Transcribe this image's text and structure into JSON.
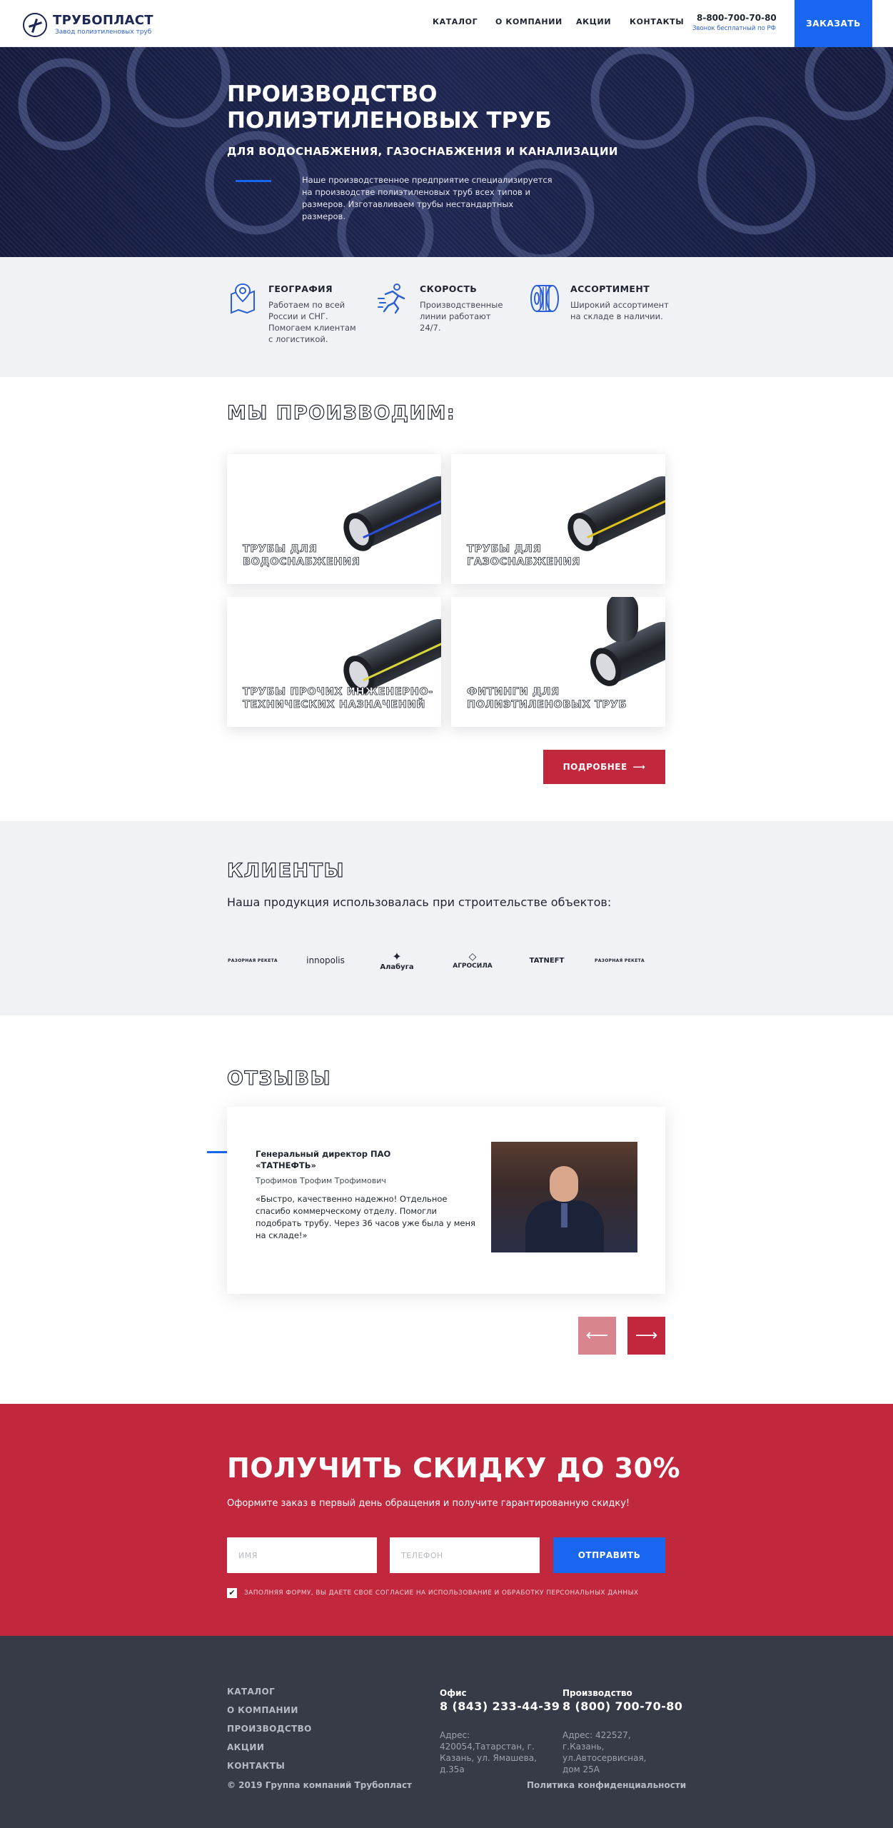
{
  "header": {
    "logo_title": "ТРУБОПЛАСТ",
    "logo_subtitle": "Завод полиэтиленовых труб",
    "nav": [
      "КАТАЛОГ",
      "О КОМПАНИИ",
      "АКЦИИ",
      "КОНТАКТЫ"
    ],
    "phone": "8-800-700-70-80",
    "phone_note": "Звонок бесплатный по РФ",
    "order_button": "ЗАКАЗАТЬ"
  },
  "hero": {
    "title": "ПРОИЗВОДСТВО ПОЛИЭТИЛЕНОВЫХ ТРУБ",
    "subtitle": "ДЛЯ ВОДОСНАБЖЕНИЯ, ГАЗОСНАБЖЕНИЯ И КАНАЛИЗАЦИИ",
    "text": "Наше производственное предприятие специализируется на производстве полиэтиленовых труб всех типов и размеров. Изготавливаем трубы нестандартных размеров."
  },
  "features": [
    {
      "icon": "map-pin-icon",
      "title": "ГЕОГРАФИЯ",
      "text": "Работаем по всей России и СНГ. Помогаем клиентам с логистикой."
    },
    {
      "icon": "running-man-icon",
      "title": "СКОРОСТЬ",
      "text": "Производственные линии работают 24/7."
    },
    {
      "icon": "pipe-coil-icon",
      "title": "АССОРТИМЕНТ",
      "text": "Широкий ассортимент на складе в наличии."
    }
  ],
  "products": {
    "title": "МЫ ПРОИЗВОДИМ:",
    "items": [
      {
        "label": "ТРУБЫ ДЛЯ ВОДОСНАБЖЕНИЯ",
        "stripe_color": "#2d4fd8"
      },
      {
        "label": "ТРУБЫ ДЛЯ ГАЗОСНАБЖЕНИЯ",
        "stripe_color": "#e0c21b"
      },
      {
        "label": "ТРУБЫ ПРОЧИХ ИНЖЕНЕРНО-ТЕХНИЧЕСКИХ НАЗНАЧЕНИЙ",
        "stripe_color": "#d8d63a"
      },
      {
        "label": "ФИТИНГИ ДЛЯ ПОЛИЭТИЛЕНОВЫХ ТРУБ",
        "stripe_color": "#2a2d33"
      }
    ],
    "more_button": "ПОДРОБНЕЕ"
  },
  "clients": {
    "title": "КЛИЕНТЫ",
    "text": "Наша продукция использовалась при строительстве объектов:",
    "logos": [
      "РАЗОРНАЯ РЕКЕТА",
      "innopolis",
      "Алабуга",
      "АГРОСИЛА",
      "TATNEFT",
      "РАЗОРНАЯ РЕКЕТА"
    ]
  },
  "reviews": {
    "title": "ОТЗЫВЫ",
    "position": "Генеральный директор ПАО «ТАТНЕФТЬ»",
    "name": "Трофимов Трофим Трофимович",
    "text": "«Быстро, качественно надежно! Отдельное спасибо коммерческому отделу. Помогли подобрать трубу. Через 36 часов уже была у меня на складе!»"
  },
  "discount": {
    "title": "ПОЛУЧИТЬ СКИДКУ ДО 30%",
    "text": "Оформите заказ в первый день обращения и получите гарантированную скидку!",
    "name_placeholder": "ИМЯ",
    "phone_placeholder": "ТЕЛЕФОН",
    "send_button": "ОТПРАВИТЬ",
    "consent": "ЗАПОЛНЯЯ ФОРМУ, ВЫ ДАЕТЕ СВОЕ СОГЛАСИЕ НА ИСПОЛЬЗОВАНИЕ И ОБРАБОТКУ ПЕРСОНАЛЬНЫХ ДАННЫХ"
  },
  "footer": {
    "links": [
      "КАТАЛОГ",
      "О КОМПАНИИ",
      "ПРОИЗВОДСТВО",
      "АКЦИИ",
      "КОНТАКТЫ"
    ],
    "office": {
      "label": "Офис",
      "phone": "8 (843) 233-44-39",
      "address": "Адрес: 420054,Татарстан, г. Казань, ул. Ямашева, д.35а"
    },
    "production": {
      "label": "Производство",
      "phone": "8 (800) 700-70-80",
      "address": "Адрес: 422527, г.Казань, ул.Автосервисная, дом 25А"
    },
    "copyright": "© 2019 Группа компаний Трубопласт",
    "privacy": "Политика конфиденциальности"
  },
  "colors": {
    "brand_blue": "#1967f0",
    "brand_red": "#c1283d",
    "navy": "#1c2753",
    "footer_bg": "#373b48"
  }
}
